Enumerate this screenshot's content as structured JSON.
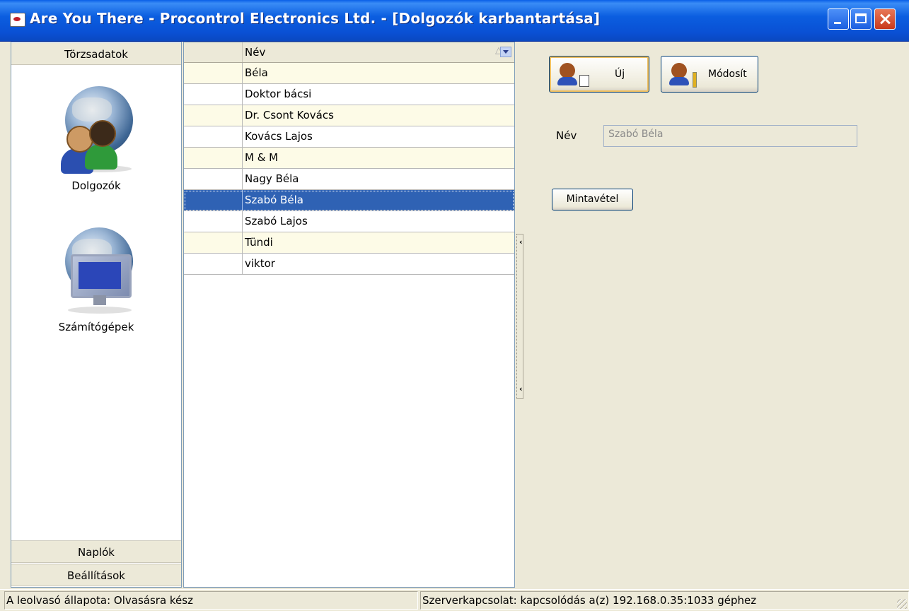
{
  "window": {
    "title": "Are You There - Procontrol Electronics Ltd. - [Dolgozók karbantartása]",
    "controls": [
      "minimize",
      "maximize",
      "close"
    ]
  },
  "sidebar": {
    "header": "Törzsadatok",
    "items": [
      {
        "label": "Dolgozók",
        "icon": "employees-globe-icon"
      },
      {
        "label": "Számítógépek",
        "icon": "computers-globe-icon"
      }
    ],
    "footer_sections": [
      "Naplók",
      "Beállítások"
    ]
  },
  "grid": {
    "column_header": "Név",
    "rows": [
      "Béla",
      "Doktor bácsi",
      "Dr. Csont Kovács",
      "Kovács Lajos",
      "M & M",
      "Nagy Béla",
      "Szabó Béla",
      "Szabó Lajos",
      "Tündi",
      "viktor"
    ],
    "selected_index": 6
  },
  "toolbar": {
    "new_label": "Új",
    "edit_label": "Módosít"
  },
  "form": {
    "name_label": "Név",
    "name_value": "Szabó Béla",
    "sample_button": "Mintavétel"
  },
  "status": {
    "reader": "A leolvasó állapota: Olvasásra kész",
    "server": "Szerverkapcsolat: kapcsolódás a(z) 192.168.0.35:1033 géphez"
  },
  "colors": {
    "title_bar": "#0b5ee0",
    "selection": "#2f62b4",
    "alt_row": "#fdfbe7",
    "face": "#ece9d8"
  }
}
